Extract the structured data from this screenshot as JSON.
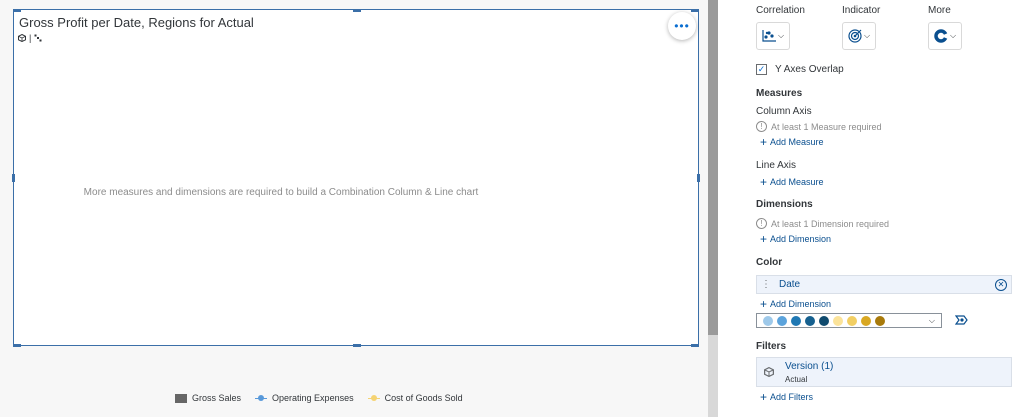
{
  "widget": {
    "title": "Gross Profit per Date, Regions for Actual",
    "more_glyph": "•••",
    "empty_message": "More measures and dimensions are required to build a Combination Column & Line chart",
    "legend": [
      {
        "label": "Gross Sales",
        "kind": "rect",
        "color": "#666666"
      },
      {
        "label": "Operating Expenses",
        "kind": "line",
        "color": "#5899da"
      },
      {
        "label": "Cost of Goods Sold",
        "kind": "line",
        "color": "#f5d372"
      }
    ]
  },
  "panel": {
    "categories": [
      {
        "label": "Correlation",
        "icon": "scatter-chart-icon"
      },
      {
        "label": "Indicator",
        "icon": "target-icon"
      },
      {
        "label": "More",
        "icon": "donut-chart-icon"
      }
    ],
    "y_axes_overlap": {
      "label": "Y Axes Overlap",
      "checked": true
    },
    "measures": {
      "title": "Measures",
      "column_axis": {
        "label": "Column Axis",
        "hint": "At least 1 Measure required",
        "add": "Add Measure"
      },
      "line_axis": {
        "label": "Line Axis",
        "add": "Add Measure"
      }
    },
    "dimensions": {
      "title": "Dimensions",
      "hint": "At least 1 Dimension required",
      "add": "Add Dimension"
    },
    "color": {
      "title": "Color",
      "token": "Date",
      "add": "Add Dimension",
      "palette": [
        "#9ec9ea",
        "#5ba3dc",
        "#1f78b4",
        "#16608f",
        "#0f4a6e",
        "#fbe39a",
        "#f2cf64",
        "#d9a823",
        "#a87a0b"
      ]
    },
    "filters": {
      "title": "Filters",
      "name": "Version (1)",
      "value": "Actual",
      "add": "Add Filters"
    }
  }
}
